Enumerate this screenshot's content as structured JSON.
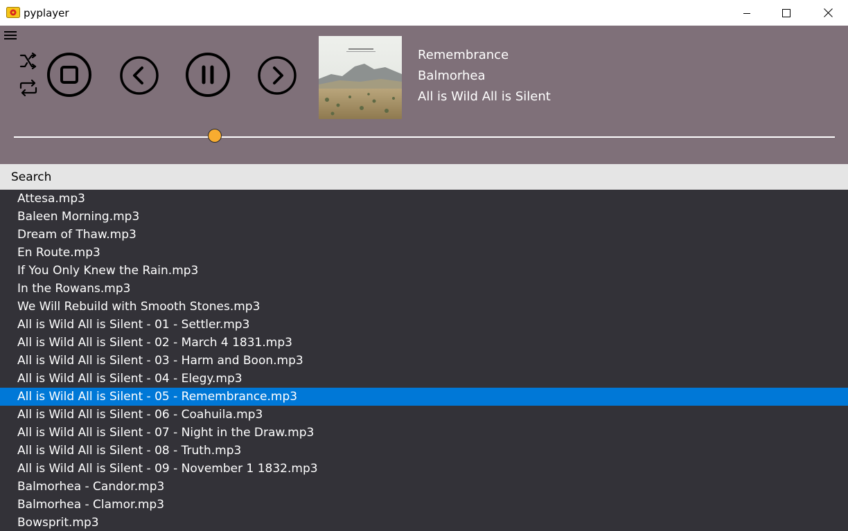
{
  "window": {
    "title": "pyplayer",
    "app_icon": "pyplayer-app-icon",
    "buttons": [
      "minimize-icon",
      "maximize-icon",
      "close-icon"
    ]
  },
  "player": {
    "menu_icon": "hamburger-menu-icon",
    "controls": [
      "shuffle-icon",
      "repeat-icon",
      "stop-icon",
      "previous-icon",
      "pause-icon",
      "next-icon"
    ],
    "now_playing": {
      "title": "Remembrance",
      "artist": "Balmorhea",
      "album": "All is Wild All is Silent"
    },
    "progress": 0.245,
    "accent_color": "#f8ac30"
  },
  "search": {
    "placeholder": "Search"
  },
  "playlist": {
    "selected_index": 11,
    "selected_color": "#0078d7",
    "items": [
      "Attesa.mp3",
      "Baleen Morning.mp3",
      "Dream of Thaw.mp3",
      "En Route.mp3",
      "If You Only Knew the Rain.mp3",
      "In the Rowans.mp3",
      "We Will Rebuild with Smooth Stones.mp3",
      "All is Wild All is Silent - 01 - Settler.mp3",
      "All is Wild All is Silent - 02 - March 4 1831.mp3",
      "All is Wild All is Silent - 03 - Harm and Boon.mp3",
      "All is Wild All is Silent - 04 - Elegy.mp3",
      "All is Wild All is Silent - 05 - Remembrance.mp3",
      "All is Wild All is Silent - 06 - Coahuila.mp3",
      "All is Wild All is Silent - 07 - Night in the Draw.mp3",
      "All is Wild All is Silent - 08 - Truth.mp3",
      "All is Wild All is Silent - 09 - November 1 1832.mp3",
      "Balmorhea - Candor.mp3",
      "Balmorhea - Clamor.mp3",
      "Bowsprit.mp3"
    ]
  },
  "colors": {
    "player_bg": "#7f7079",
    "list_bg": "#333238",
    "search_bg": "#e5e5e5"
  }
}
